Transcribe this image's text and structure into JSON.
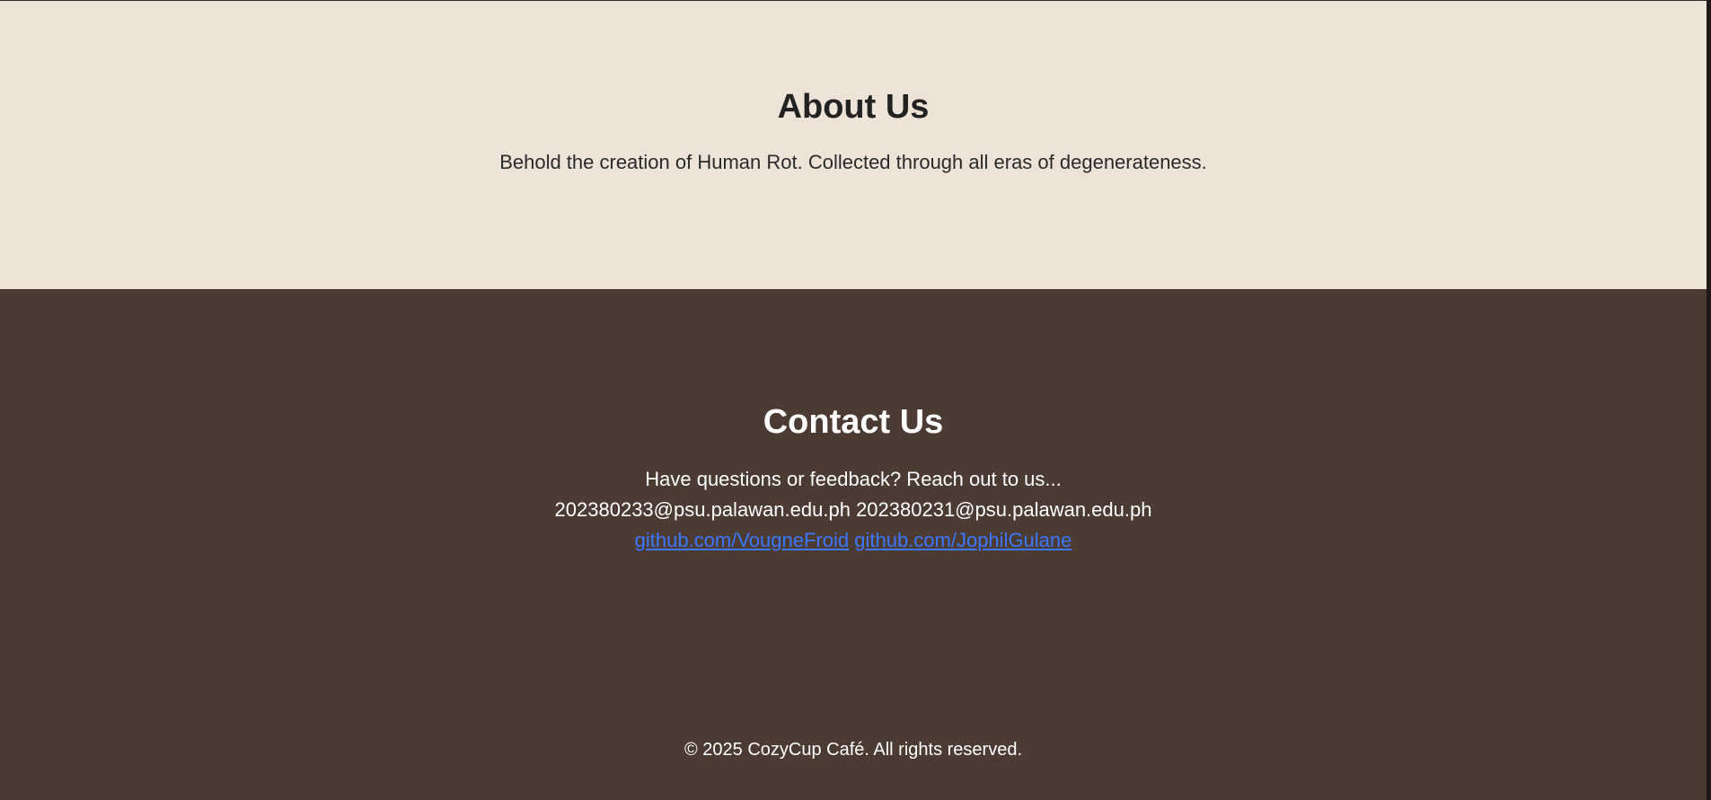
{
  "about": {
    "title": "About Us",
    "description": "Behold the creation of Human Rot. Collected through all eras of degenerateness."
  },
  "contact": {
    "title": "Contact Us",
    "prompt": "Have questions or feedback? Reach out to us...",
    "emails": [
      "202380233@psu.palawan.edu.ph",
      "202380231@psu.palawan.edu.ph"
    ],
    "links": [
      "github.com/VougneFroid",
      "github.com/JophilGulane"
    ]
  },
  "footer": {
    "copyright": "© 2025 CozyCup Café. All rights reserved."
  },
  "colors": {
    "about_bg": "#ede3d6",
    "contact_bg": "#4b3b32",
    "link": "#3b78ff",
    "heading_dark": "#222222",
    "text_light": "#ffffff"
  }
}
